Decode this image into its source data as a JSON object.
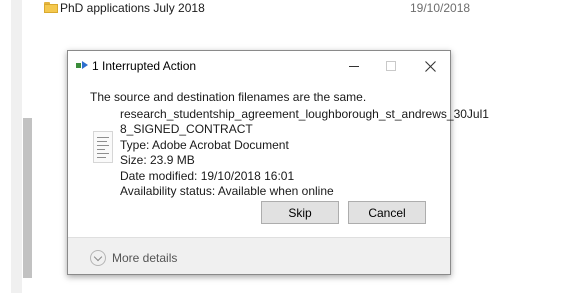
{
  "explorer": {
    "row": {
      "name": "PhD applications July 2018",
      "date": "19/10/2018"
    }
  },
  "dialog": {
    "title": "1 Interrupted Action",
    "message": "The source and destination filenames are the same.",
    "file": {
      "name_line1": "research_studentship_agreement_loughborough_st_andrews_30Jul1",
      "name_line2": "8_SIGNED_CONTRACT",
      "type": "Type: Adobe Acrobat Document",
      "size": "Size: 23.9 MB",
      "date_modified": "Date modified: 19/10/2018 16:01",
      "availability": "Availability status: Available when online"
    },
    "buttons": {
      "skip": "Skip",
      "cancel": "Cancel"
    },
    "more_details": "More details",
    "icons": {
      "title": "copy-progress-icon",
      "file": "pdf-document-icon",
      "minimize": "minimize-icon",
      "maximize": "maximize-icon",
      "close": "close-icon",
      "details": "chevron-down-icon"
    }
  }
}
